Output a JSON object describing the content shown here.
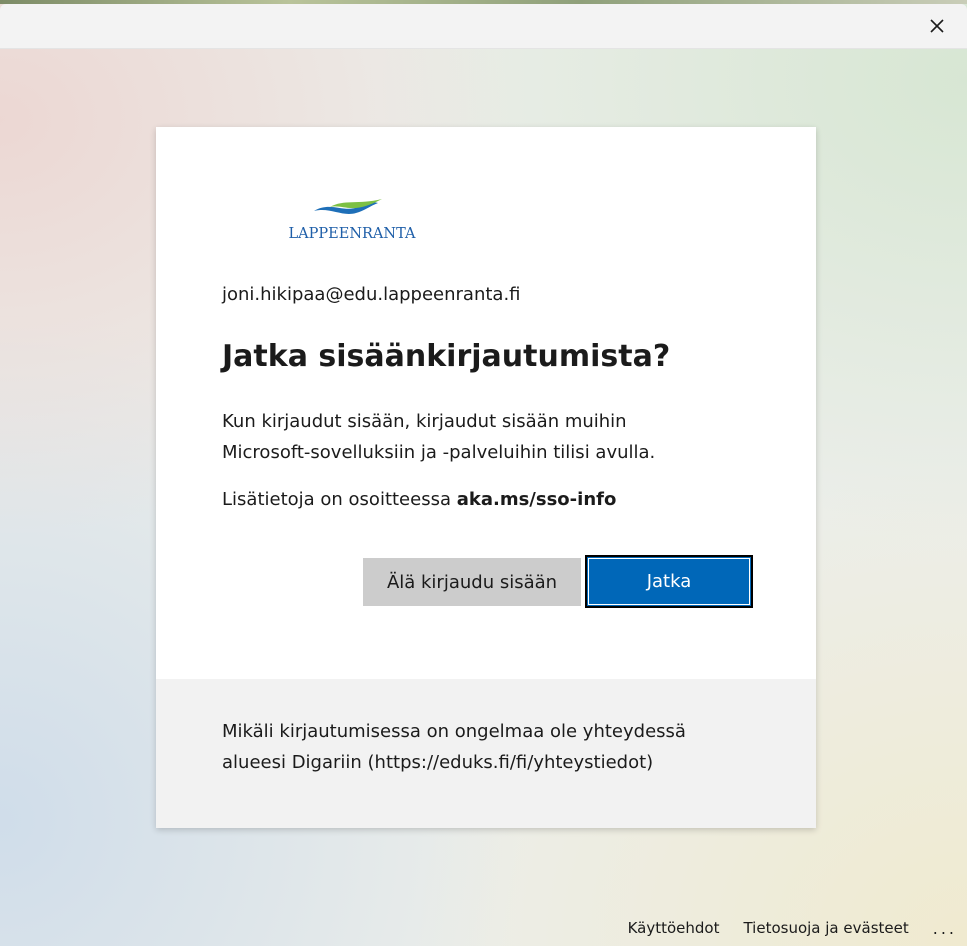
{
  "window": {
    "close_icon": "close-icon"
  },
  "brand": {
    "logo_text": "LAPPEENRANTA",
    "wave_blue": "#1e6fb8",
    "wave_green": "#7cc043"
  },
  "signin": {
    "email": "joni.hikipaa@edu.lappeenranta.fi",
    "title": "Jatka sisäänkirjautumista?",
    "description_line1": "Kun kirjaudut sisään, kirjaudut sisään muihin",
    "description_line2": "Microsoft-sovelluksiin ja -palveluihin tilisi avulla.",
    "info_prefix": "Lisätietoja on osoitteessa",
    "info_link": "aka.ms/sso-info",
    "cancel_label": "Älä kirjaudu sisään",
    "continue_label": "Jatka"
  },
  "help": {
    "line1": "Mikäli kirjautumisessa on ongelmaa ole yhteydessä",
    "line2": "alueesi Digariin (https://eduks.fi/fi/yhteystiedot)"
  },
  "footer": {
    "terms": "Käyttöehdot",
    "privacy": "Tietosuoja ja evästeet",
    "more": "..."
  },
  "colors": {
    "accent": "#0067b8",
    "secondary_button": "#cccccc",
    "footer_panel": "#f2f2f2"
  }
}
